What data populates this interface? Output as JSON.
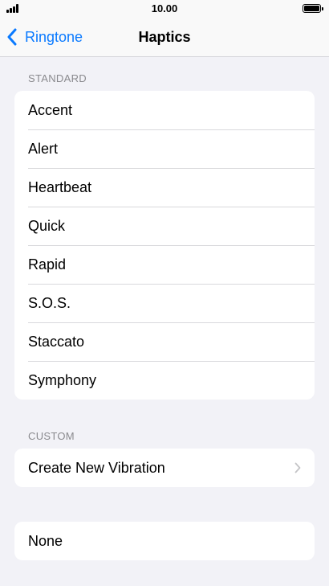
{
  "status_bar": {
    "time": "10.00"
  },
  "nav": {
    "back_label": "Ringtone",
    "title": "Haptics"
  },
  "standard": {
    "header": "STANDARD",
    "items": [
      "Accent",
      "Alert",
      "Heartbeat",
      "Quick",
      "Rapid",
      "S.O.S.",
      "Staccato",
      "Symphony"
    ]
  },
  "custom": {
    "header": "CUSTOM",
    "create_label": "Create New Vibration"
  },
  "none_label": "None",
  "colors": {
    "accent": "#0a7aff",
    "background": "#f2f2f7",
    "section_header": "#8a8a8e"
  }
}
